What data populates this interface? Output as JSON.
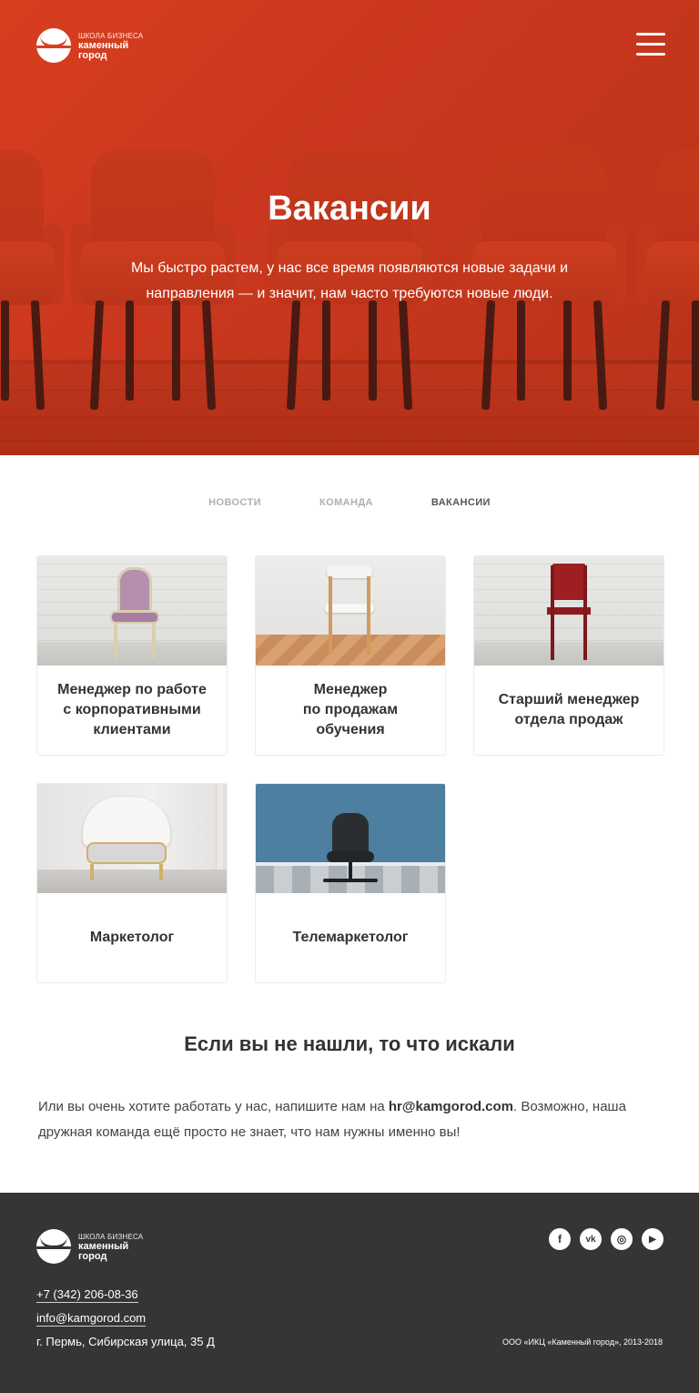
{
  "logo": {
    "small": "ШКОЛА БИЗНЕСА",
    "line1": "каменный",
    "line2": "город"
  },
  "hero": {
    "title": "Вакансии",
    "subtitle": "Мы быстро растем, у нас все время появляются новые задачи и направления — и значит, нам часто требуются новые люди."
  },
  "tabs": [
    {
      "label": "НОВОСТИ",
      "active": false
    },
    {
      "label": "КОМАНДА",
      "active": false
    },
    {
      "label": "ВАКАНСИИ",
      "active": true
    }
  ],
  "vacancies": [
    {
      "title": "Менеджер по работе\nс корпоративными\nклиентами",
      "image": "antique-purple-chair"
    },
    {
      "title": "Менеджер\nпо продажам\nобучения",
      "image": "white-wooden-chair"
    },
    {
      "title": "Старший менеджер\nотдела продаж",
      "image": "red-chair"
    },
    {
      "title": "Маркетолог",
      "image": "white-armchair"
    },
    {
      "title": "Телемаркетолог",
      "image": "office-chair"
    }
  ],
  "not_found": {
    "title": "Если вы не нашли, то что искали",
    "text_before": "Или вы очень хотите работать у нас, напишите нам на ",
    "email": "hr@kamgorod.com",
    "text_after": ". Возможно, наша дружная команда ещё просто не знает, что нам нужны именно вы!"
  },
  "footer": {
    "phone": "+7 (342) 206-08-36",
    "email": "info@kamgorod.com",
    "address": "г. Пермь, Сибирская улица, 35 Д",
    "copyright": "ООО «ИКЦ «Каменный город», 2013-2018",
    "social": [
      {
        "icon": "facebook-icon",
        "glyph": "f"
      },
      {
        "icon": "vk-icon",
        "glyph": "vk"
      },
      {
        "icon": "instagram-icon",
        "glyph": "◎"
      },
      {
        "icon": "youtube-icon",
        "glyph": "▶"
      }
    ]
  },
  "colors": {
    "accent": "#d9401f",
    "footer_bg": "#353535"
  }
}
